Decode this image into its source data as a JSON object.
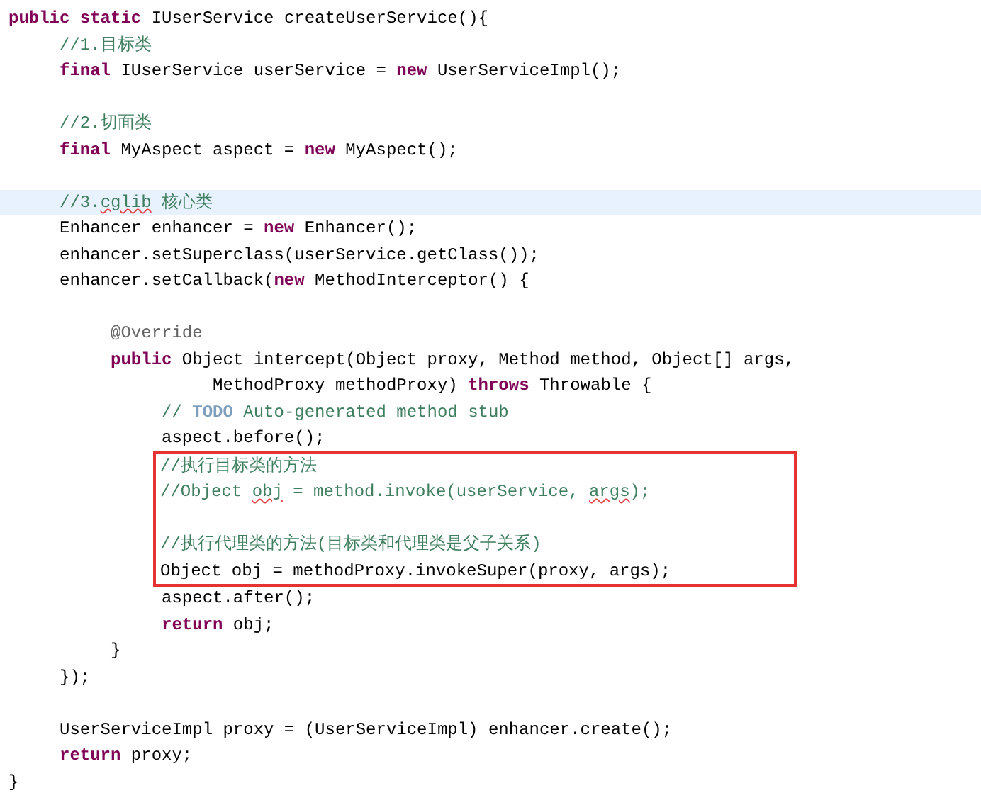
{
  "editor": {
    "blocks": [
      {
        "kind": "line",
        "tokens": [
          {
            "kind": "keyword",
            "text": "public static"
          },
          {
            "kind": "plain",
            "text": " IUserService createUserService(){"
          }
        ]
      },
      {
        "kind": "line",
        "tokens": [
          {
            "kind": "comment",
            "text": "     //1.目标类"
          }
        ]
      },
      {
        "kind": "line",
        "tokens": [
          {
            "kind": "keyword",
            "text": "     final"
          },
          {
            "kind": "plain",
            "text": " IUserService userService = "
          },
          {
            "kind": "keyword",
            "text": "new"
          },
          {
            "kind": "plain",
            "text": " UserServiceImpl();"
          }
        ]
      },
      {
        "kind": "blank"
      },
      {
        "kind": "line",
        "tokens": [
          {
            "kind": "comment",
            "text": "     //2.切面类"
          }
        ]
      },
      {
        "kind": "line",
        "tokens": [
          {
            "kind": "keyword",
            "text": "     final"
          },
          {
            "kind": "plain",
            "text": " MyAspect aspect = "
          },
          {
            "kind": "keyword",
            "text": "new"
          },
          {
            "kind": "plain",
            "text": " MyAspect();"
          }
        ]
      },
      {
        "kind": "blank"
      },
      {
        "kind": "line",
        "current": true,
        "tokens": [
          {
            "kind": "comment",
            "text": "     //3."
          },
          {
            "kind": "comment",
            "text": "cglib",
            "squiggle": true
          },
          {
            "kind": "comment",
            "text": " 核心类"
          }
        ]
      },
      {
        "kind": "line",
        "tokens": [
          {
            "kind": "plain",
            "text": "     Enhancer enhancer = "
          },
          {
            "kind": "keyword",
            "text": "new"
          },
          {
            "kind": "plain",
            "text": " Enhancer();"
          }
        ]
      },
      {
        "kind": "line",
        "tokens": [
          {
            "kind": "plain",
            "text": "     enhancer.setSuperclass(userService.getClass());"
          }
        ]
      },
      {
        "kind": "line",
        "tokens": [
          {
            "kind": "plain",
            "text": "     enhancer.setCallback("
          },
          {
            "kind": "keyword",
            "text": "new"
          },
          {
            "kind": "plain",
            "text": " MethodInterceptor() {"
          }
        ]
      },
      {
        "kind": "blank"
      },
      {
        "kind": "line",
        "tokens": [
          {
            "kind": "annotation",
            "text": "          @Override"
          }
        ]
      },
      {
        "kind": "line",
        "tokens": [
          {
            "kind": "keyword",
            "text": "          public"
          },
          {
            "kind": "plain",
            "text": " Object intercept(Object proxy, Method method, Object[] args,"
          }
        ]
      },
      {
        "kind": "line",
        "tokens": [
          {
            "kind": "plain",
            "text": "                    MethodProxy methodProxy) "
          },
          {
            "kind": "keyword",
            "text": "throws"
          },
          {
            "kind": "plain",
            "text": " Throwable {"
          }
        ]
      },
      {
        "kind": "line",
        "tokens": [
          {
            "kind": "comment",
            "text": "               // "
          },
          {
            "kind": "todo",
            "text": "TODO"
          },
          {
            "kind": "comment",
            "text": " Auto-generated method stub"
          }
        ]
      },
      {
        "kind": "line",
        "tokens": [
          {
            "kind": "plain",
            "text": "               aspect.before();"
          }
        ]
      },
      {
        "kind": "box",
        "lines": [
          {
            "tokens": [
              {
                "kind": "comment",
                "text": "//执行目标类的方法"
              }
            ]
          },
          {
            "tokens": [
              {
                "kind": "comment",
                "text": "//Object "
              },
              {
                "kind": "comment",
                "text": "obj",
                "squiggle": true
              },
              {
                "kind": "comment",
                "text": " = method.invoke(userService, "
              },
              {
                "kind": "comment",
                "text": "args",
                "squiggle": true
              },
              {
                "kind": "comment",
                "text": ");"
              }
            ]
          },
          {
            "kind": "blank"
          },
          {
            "tokens": [
              {
                "kind": "comment",
                "text": "//执行代理类的方法(目标类和代理类是父子关系)"
              }
            ]
          },
          {
            "tokens": [
              {
                "kind": "plain",
                "text": "Object obj = methodProxy.invokeSuper(proxy, args);"
              }
            ]
          }
        ]
      },
      {
        "kind": "line",
        "tokens": [
          {
            "kind": "plain",
            "text": "               aspect.after();"
          }
        ]
      },
      {
        "kind": "line",
        "tokens": [
          {
            "kind": "keyword",
            "text": "               return"
          },
          {
            "kind": "plain",
            "text": " obj;"
          }
        ]
      },
      {
        "kind": "line",
        "tokens": [
          {
            "kind": "plain",
            "text": "          }"
          }
        ]
      },
      {
        "kind": "line",
        "tokens": [
          {
            "kind": "plain",
            "text": "     });"
          }
        ]
      },
      {
        "kind": "blank"
      },
      {
        "kind": "line",
        "tokens": [
          {
            "kind": "plain",
            "text": "     UserServiceImpl proxy = (UserServiceImpl) enhancer.create();"
          }
        ]
      },
      {
        "kind": "line",
        "tokens": [
          {
            "kind": "keyword",
            "text": "     return"
          },
          {
            "kind": "plain",
            "text": " proxy;"
          }
        ]
      },
      {
        "kind": "line",
        "tokens": [
          {
            "kind": "plain",
            "text": "}"
          }
        ]
      }
    ]
  }
}
